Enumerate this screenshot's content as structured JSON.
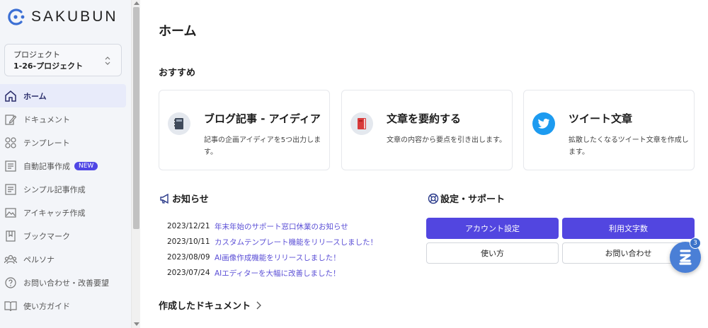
{
  "app": {
    "name": "SAKUBUN"
  },
  "project": {
    "label": "プロジェクト",
    "value": "1-26-プロジェクト"
  },
  "sidebar": {
    "items": [
      {
        "label": "ホーム",
        "icon": "home-icon",
        "active": true
      },
      {
        "label": "ドキュメント",
        "icon": "pencil-icon"
      },
      {
        "label": "テンプレート",
        "icon": "grid-icon"
      },
      {
        "label": "自動記事作成",
        "icon": "document-icon",
        "badge": "NEW"
      },
      {
        "label": "シンプル記事作成",
        "icon": "document-icon"
      },
      {
        "label": "アイキャッチ作成",
        "icon": "image-icon"
      },
      {
        "label": "ブックマーク",
        "icon": "bookmark-icon"
      },
      {
        "label": "ペルソナ",
        "icon": "users-icon"
      },
      {
        "label": "お問い合わせ・改善要望",
        "icon": "help-icon"
      },
      {
        "label": "使い方ガイド",
        "icon": "book-icon"
      }
    ]
  },
  "main": {
    "title": "ホーム",
    "recommend_title": "おすすめ",
    "cards": [
      {
        "title": "ブログ記事 - アイディア",
        "desc": "記事の企画アイディアを5つ出力します。",
        "icon": "notebook-icon"
      },
      {
        "title": "文章を要約する",
        "desc": "文章の内容から要点を引き出します。",
        "icon": "red-book-icon"
      },
      {
        "title": "ツイート文章",
        "desc": "拡散したくなるツイート文章を作成します。",
        "icon": "twitter-icon"
      }
    ],
    "news_title": "お知らせ",
    "news": [
      {
        "date": "2023/12/21",
        "text": "年末年始のサポート窓口休業のお知らせ"
      },
      {
        "date": "2023/10/11",
        "text": "カスタムテンプレート機能をリリースしました！"
      },
      {
        "date": "2023/08/09",
        "text": "AI画像作成機能をリリースしました！"
      },
      {
        "date": "2023/07/24",
        "text": "AIエディターを大幅に改善しました！"
      }
    ],
    "settings_title": "設定・サポート",
    "buttons": {
      "account": "アカウント設定",
      "usage": "利用文字数",
      "howto": "使い方",
      "contact": "お問い合わせ"
    },
    "documents_title": "作成したドキュメント"
  },
  "chat": {
    "badge_count": "3"
  },
  "colors": {
    "accent": "#5246e0",
    "link": "#5b4fd6",
    "sidebar_bg": "#f3f5f9",
    "brand_blue": "#3b6fd4"
  }
}
